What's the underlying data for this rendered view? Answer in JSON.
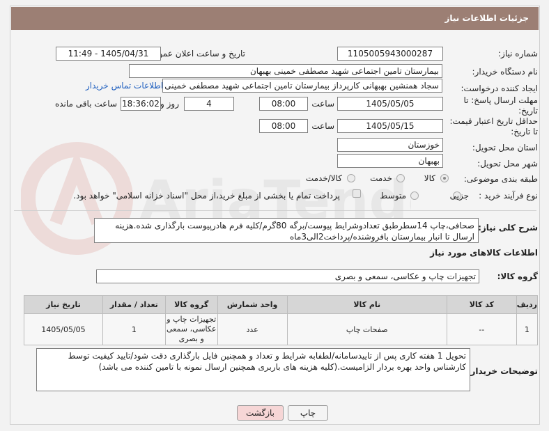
{
  "header": {
    "title": "جزئیات اطلاعات نیاز"
  },
  "form": {
    "need_number": {
      "label": "شماره نیاز:",
      "value": "1105005943000287"
    },
    "announce": {
      "label": "تاریخ و ساعت اعلان عمومی:",
      "value": "1405/04/31 - 11:49"
    },
    "buyer_org": {
      "label": "نام دستگاه خریدار:",
      "value": "بیمارستان تامین اجتماعی شهید مصطفی خمینی بهبهان"
    },
    "creator": {
      "label": "ایجاد کننده درخواست:",
      "value": "سجاد همنشین بهبهانی کارپرداز بیمارستان تامین اجتماعی شهید مصطفی خمینی",
      "contact_link": "اطلاعات تماس خریدار"
    },
    "reply_deadline": {
      "label_line1": "مهلت ارسال پاسخ: تا",
      "label_line2": "تاریخ:",
      "date": "1405/05/05",
      "time_label": "ساعت",
      "time": "08:00",
      "days": "4",
      "days_label": "روز و",
      "remaining": "18:36:02",
      "remaining_label": "ساعت باقی مانده"
    },
    "price_validity": {
      "label_line1": "حداقل تاریخ اعتبار قیمت:",
      "label_line2": "تا تاریخ:",
      "date": "1405/05/15",
      "time_label": "ساعت",
      "time": "08:00"
    },
    "province": {
      "label": "استان محل تحویل:",
      "value": "خوزستان"
    },
    "city": {
      "label": "شهر محل تحویل:",
      "value": "بهبهان"
    },
    "category": {
      "label": "طبقه بندی موضوعی:",
      "options": [
        "کالا",
        "خدمت",
        "کالا/خدمت"
      ],
      "selected": "کالا"
    },
    "purchase_type": {
      "label": "نوع فرآیند خرید :",
      "options": [
        "جزیی",
        "متوسط"
      ],
      "note": "پرداخت تمام یا بخشی از مبلغ خرید،از محل \"اسناد خزانه اسلامی\" خواهد بود."
    },
    "summary": {
      "label": "شرح کلی نیاز:",
      "value": "صحافی،چاپ 14سطرطبق تعدادوشرایط پیوست/برگه 80گرم/کلیه فرم هادرپیوست بارگذاری شده.هزینه ارسال تا انبار بیمارستان بافروشنده/پرداخت2الی3ماه"
    }
  },
  "goods": {
    "section_title": "اطلاعات کالاهای مورد نیاز",
    "group_label": "گروه کالا:",
    "group_value": "تجهیزات چاپ و عکاسی، سمعی و بصری",
    "columns": [
      "ردیف",
      "کد کالا",
      "نام کالا",
      "واحد شمارش",
      "گروه کالا",
      "تعداد / مقدار",
      "تاریخ نیاز"
    ],
    "rows": [
      {
        "row": "1",
        "code": "--",
        "name": "صفحات چاپ",
        "unit": "عدد",
        "group": "تجهیزات چاپ و عکاسی، سمعی و بصری",
        "qty": "1",
        "date": "1405/05/05"
      }
    ]
  },
  "buyer_notes": {
    "label": "توضیحات خریدار:",
    "value": "تحویل 1 هفته کاری پس از تاییدسامانه/لطفابه شرایط و تعداد و همچنین فایل بارگذاری دقت شود/تایید کیفیت توسط کارشناس واحد بهره بردار الزامیست.(کلیه هزینه های باربری همچنین ارسال نمونه با تامین کننده می باشد)"
  },
  "buttons": {
    "print": "چاپ",
    "back": "بازگشت"
  },
  "colors": {
    "titlebar": "#9c7f74",
    "back_button": "#f6d6d6",
    "link": "#1f5fbf"
  }
}
